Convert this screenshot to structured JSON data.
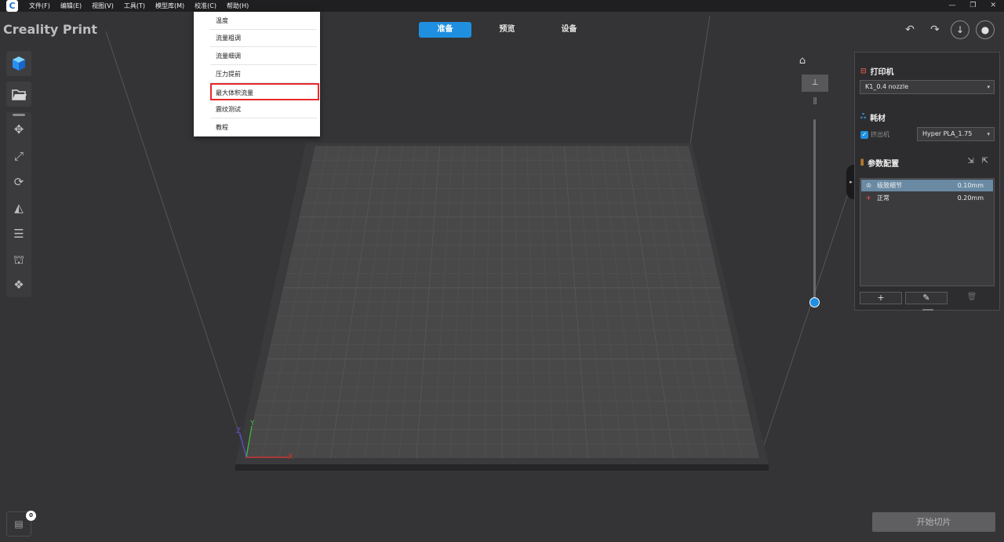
{
  "app": {
    "logo_glyph": "C",
    "title": "Creality Print"
  },
  "menubar": {
    "items": [
      "文件(F)",
      "编辑(E)",
      "视图(V)",
      "工具(T)",
      "模型库(M)",
      "校准(C)",
      "帮助(H)"
    ]
  },
  "window_controls": {
    "minimize": "—",
    "restore": "❐",
    "close": "✕"
  },
  "tabs": [
    {
      "label": "准备",
      "active": true
    },
    {
      "label": "预览",
      "active": false
    },
    {
      "label": "设备",
      "active": false
    }
  ],
  "top_right": {
    "undo_icon": "undo-icon",
    "redo_icon": "redo-icon",
    "download_icon": "download-icon",
    "account_icon": "user-icon"
  },
  "calibration_menu": {
    "items": [
      {
        "label": "温度",
        "highlighted": false
      },
      {
        "label": "流量粗调",
        "highlighted": false
      },
      {
        "label": "流量细调",
        "highlighted": false
      },
      {
        "label": "压力提前",
        "highlighted": false
      },
      {
        "label": "最大体积流量",
        "highlighted": true
      },
      {
        "label": "震纹测试",
        "highlighted": false
      },
      {
        "label": "教程",
        "highlighted": false
      }
    ]
  },
  "right_panel": {
    "printer": {
      "title": "打印机",
      "selected": "K1_0.4 nozzle"
    },
    "material": {
      "title": "耗材",
      "extruder_label": "挤出机",
      "extruder_checked": true,
      "selected": "Hyper PLA_1.75"
    },
    "params": {
      "title": "参数配置",
      "profiles": [
        {
          "name": "极致细节",
          "value": "0.10mm",
          "selected": true
        },
        {
          "name": "正常",
          "value": "0.20mm",
          "selected": false
        }
      ],
      "add_label": "+",
      "edit_label": "✎",
      "delete_label": "🗑"
    }
  },
  "axes": {
    "x": "X",
    "y": "Y",
    "z": "Z"
  },
  "colors": {
    "accent": "#1f90e0",
    "highlight_border": "#e8282b",
    "axis_x": "#e0302a",
    "axis_y": "#3cc23c",
    "axis_z": "#5b4fe0"
  },
  "bottom": {
    "message_count": "0",
    "slice_button": "开始切片"
  }
}
